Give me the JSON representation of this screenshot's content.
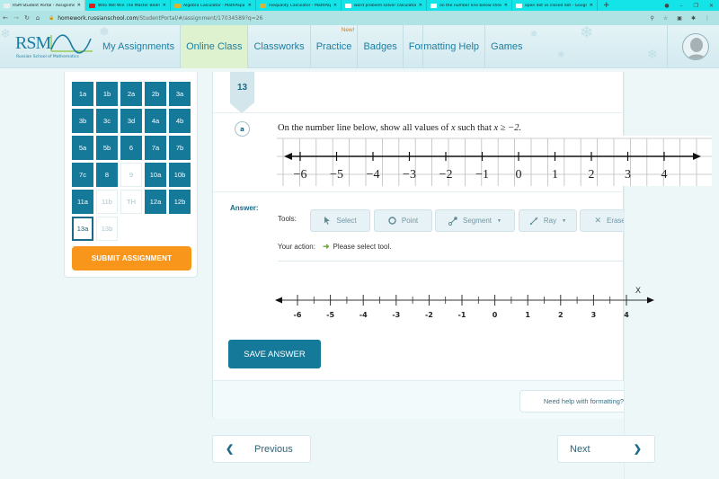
{
  "browser": {
    "tabs": [
      {
        "label": "RSM Student Portal - Assignme",
        "favicon": "rsm-favicon",
        "color": "#e8f0f0",
        "active": true
      },
      {
        "label": "Who Will Win The Master Bedro",
        "favicon": "youtube-favicon",
        "color": "#e02020",
        "active": false
      },
      {
        "label": "Algebra Calculator - MathPapa",
        "favicon": "mathpapa-favicon",
        "color": "#d8b43a",
        "active": false
      },
      {
        "label": "Inequality Calculator - MathPapa",
        "favicon": "mathpapa-favicon",
        "color": "#d8b43a",
        "active": false
      },
      {
        "label": "word problem solver calculator",
        "favicon": "google-favicon",
        "color": "#ffffff",
        "active": false
      },
      {
        "label": "on the number line below show",
        "favicon": "google-favicon",
        "color": "#ffffff",
        "active": false
      },
      {
        "label": "open dot vs closed dot - Google",
        "favicon": "google-favicon",
        "color": "#ffffff",
        "active": false
      }
    ],
    "new_tab": "+",
    "url_host": "homework.russianschool.com",
    "url_path": "/StudentPortal/#/assignment/17034589?q=26"
  },
  "header": {
    "logo_text": "RSM",
    "logo_subtitle": "Russian School of Mathematics",
    "nav": [
      {
        "label": "My Assignments",
        "active": false
      },
      {
        "label": "Online Class",
        "active": true
      },
      {
        "label": "Classworks",
        "active": false
      },
      {
        "label": "Practice",
        "active": false,
        "badge": "New!"
      },
      {
        "label": "Badges",
        "active": false
      },
      {
        "label": "Formatting Help",
        "active": false
      },
      {
        "label": "Games",
        "active": false
      }
    ]
  },
  "sidebar": {
    "questions": [
      {
        "label": "1a",
        "state": "done"
      },
      {
        "label": "1b",
        "state": "done"
      },
      {
        "label": "2a",
        "state": "done"
      },
      {
        "label": "2b",
        "state": "done"
      },
      {
        "label": "3a",
        "state": "done"
      },
      {
        "label": "3b",
        "state": "done"
      },
      {
        "label": "3c",
        "state": "done"
      },
      {
        "label": "3d",
        "state": "done"
      },
      {
        "label": "4a",
        "state": "done"
      },
      {
        "label": "4b",
        "state": "done"
      },
      {
        "label": "5a",
        "state": "done"
      },
      {
        "label": "5b",
        "state": "done"
      },
      {
        "label": "6",
        "state": "done"
      },
      {
        "label": "7a",
        "state": "done"
      },
      {
        "label": "7b",
        "state": "done"
      },
      {
        "label": "7c",
        "state": "done"
      },
      {
        "label": "8",
        "state": "done"
      },
      {
        "label": "9",
        "state": "empty"
      },
      {
        "label": "10a",
        "state": "done"
      },
      {
        "label": "10b",
        "state": "done"
      },
      {
        "label": "11a",
        "state": "done"
      },
      {
        "label": "11b",
        "state": "empty"
      },
      {
        "label": "TH",
        "state": "empty"
      },
      {
        "label": "12a",
        "state": "done"
      },
      {
        "label": "12b",
        "state": "done"
      },
      {
        "label": "13a",
        "state": "current"
      },
      {
        "label": "13b",
        "state": "empty"
      }
    ],
    "submit_label": "SUBMIT ASSIGNMENT"
  },
  "question": {
    "number": "13",
    "part": "a",
    "text_prefix": "On the number line below, show all values of ",
    "var": "x",
    "text_mid": " such that ",
    "inequality": "x ≥ −2.",
    "figure_ticks": [
      "−6",
      "−5",
      "−4",
      "−3",
      "−2",
      "−1",
      "0",
      "1",
      "2",
      "3",
      "4"
    ]
  },
  "answer": {
    "label": "Answer:",
    "tools_label": "Tools:",
    "tools": [
      {
        "label": "Select",
        "icon": "cursor-icon",
        "dropdown": false
      },
      {
        "label": "Point",
        "icon": "circle-icon",
        "dropdown": false
      },
      {
        "label": "Segment",
        "icon": "segment-icon",
        "dropdown": true
      },
      {
        "label": "Ray",
        "icon": "ray-icon",
        "dropdown": true
      },
      {
        "label": "Eraser",
        "icon": "x-icon",
        "dropdown": false
      }
    ],
    "action_label": "Your action:",
    "action_text": "Please select tool.",
    "axis_label": "X",
    "ticks": [
      "-6",
      "-5",
      "-4",
      "-3",
      "-2",
      "-1",
      "0",
      "1",
      "2",
      "3",
      "4"
    ],
    "save_label": "SAVE ANSWER",
    "help_label": "Need help with formatting?"
  },
  "pager": {
    "prev_label": "Previous",
    "next_label": "Next"
  }
}
